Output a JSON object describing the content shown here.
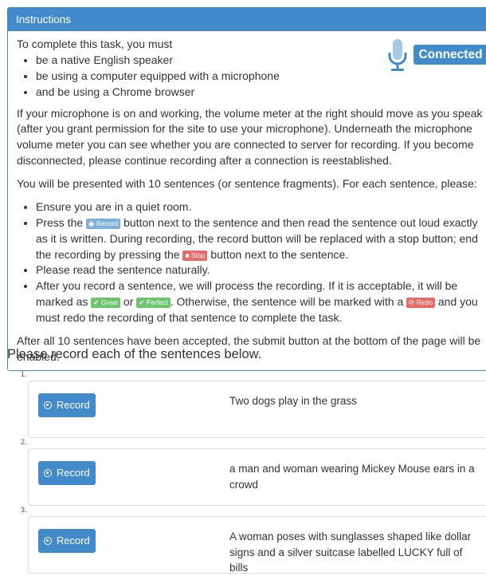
{
  "instructions": {
    "heading": "Instructions",
    "intro": "To complete this task, you must",
    "requirements": [
      "be a native English speaker",
      "be using a computer equipped with a microphone",
      "and be using a Chrome browser"
    ],
    "connection_status": "Connected",
    "mic_paragraph": "If your microphone is on and working, the volume meter at the right should move as you speak (after you grant permission for the site to use your microphone). Underneath the microphone volume meter you can see whether you are connected to server for recording. If you become disconnected, please continue recording after a connection is reestablished.",
    "presented_paragraph": "You will be presented with 10 sentences (or sentence fragments). For each sentence, please:",
    "steps": {
      "quiet_room": "Ensure you are in a quiet room.",
      "press_prefix": "Press the",
      "record_label": "Record",
      "press_suffix": "button next to the sentence and then read the sentence out loud exactly as it is written. During recording, the record button will be replaced with a stop button; end the recording by pressing the",
      "stop_label": "Stop",
      "stop_suffix": "button next to the sentence.",
      "read_naturally": "Please read the sentence naturally.",
      "after_prefix": "After you record a sentence, we will process the recording. If it is acceptable, it will be marked as",
      "great_label": "Great",
      "or_text": "or",
      "perfect_label": "Perfect",
      "otherwise_text": ". Otherwise, the sentence will be marked with a",
      "redo_label": "Redo",
      "redo_suffix": "and you must redo the recording of that sentence to complete the task."
    },
    "final_paragraph": "After all 10 sentences have been accepted, the submit button at the bottom of the page will be enabled."
  },
  "prompt": "Please record each of the sentences below.",
  "sentences": [
    {
      "number": "1.",
      "button": "Record",
      "text": "Two dogs play in the grass"
    },
    {
      "number": "2.",
      "button": "Record",
      "text": "a man and woman wearing Mickey Mouse ears in a crowd"
    },
    {
      "number": "3.",
      "button": "Record",
      "text": "A woman poses with sunglasses shaped like dollar signs and a silver suitcase labelled LUCKY full of bills"
    }
  ],
  "colors": {
    "primary": "#428bca",
    "danger": "#d9534f",
    "success": "#5cb85c"
  },
  "icons": [
    "microphone-icon",
    "record-circle-icon",
    "stop-icon",
    "check-icon",
    "redo-icon"
  ]
}
